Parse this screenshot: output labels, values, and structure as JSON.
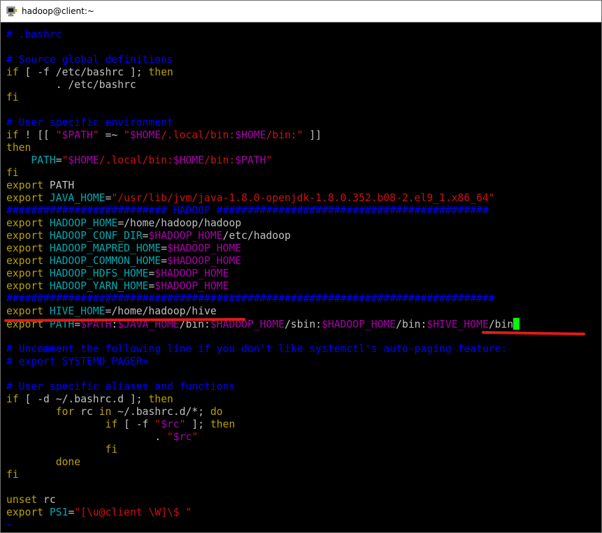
{
  "window": {
    "title": "hadoop@client:~"
  },
  "terminal": {
    "lines": [
      [
        {
          "t": "# .bashrc",
          "c": "comment"
        }
      ],
      [],
      [
        {
          "t": "# Source global definitions",
          "c": "comment"
        }
      ],
      [
        {
          "t": "if",
          "c": "keyword"
        },
        {
          "t": " [ -f /etc/bashrc ]; ",
          "c": "plain"
        },
        {
          "t": "then",
          "c": "keyword"
        }
      ],
      [
        {
          "t": "        . /etc/bashrc",
          "c": "plain"
        }
      ],
      [
        {
          "t": "fi",
          "c": "keyword"
        }
      ],
      [],
      [
        {
          "t": "# User specific environment",
          "c": "comment"
        }
      ],
      [
        {
          "t": "if",
          "c": "keyword"
        },
        {
          "t": " ! [[ ",
          "c": "plain"
        },
        {
          "t": "\"",
          "c": "string"
        },
        {
          "t": "$PATH",
          "c": "var"
        },
        {
          "t": "\"",
          "c": "string"
        },
        {
          "t": " =~ ",
          "c": "plain"
        },
        {
          "t": "\"",
          "c": "string"
        },
        {
          "t": "$HOME",
          "c": "var"
        },
        {
          "t": "/.local/bin:",
          "c": "string"
        },
        {
          "t": "$HOME",
          "c": "var"
        },
        {
          "t": "/bin:\"",
          "c": "string"
        },
        {
          "t": " ]]",
          "c": "plain"
        }
      ],
      [
        {
          "t": "then",
          "c": "keyword"
        }
      ],
      [
        {
          "t": "    PATH",
          "c": "cyan"
        },
        {
          "t": "=",
          "c": "plain"
        },
        {
          "t": "\"",
          "c": "string"
        },
        {
          "t": "$HOME",
          "c": "var"
        },
        {
          "t": "/.local/bin:",
          "c": "string"
        },
        {
          "t": "$HOME",
          "c": "var"
        },
        {
          "t": "/bin:",
          "c": "string"
        },
        {
          "t": "$PATH",
          "c": "var"
        },
        {
          "t": "\"",
          "c": "string"
        }
      ],
      [
        {
          "t": "fi",
          "c": "keyword"
        }
      ],
      [
        {
          "t": "export",
          "c": "keyword"
        },
        {
          "t": " PATH",
          "c": "plain"
        }
      ],
      [
        {
          "t": "export",
          "c": "keyword"
        },
        {
          "t": " JAVA_HOME",
          "c": "cyan"
        },
        {
          "t": "=",
          "c": "plain"
        },
        {
          "t": "\"/usr/lib/jvm/java-1.8.0-openjdk-1.8.0.352.b08-2.el9_1.x86_64\"",
          "c": "string"
        }
      ],
      [
        {
          "t": "########################## HADOOP ############################################",
          "c": "comment"
        }
      ],
      [
        {
          "t": "export",
          "c": "keyword"
        },
        {
          "t": " HADOOP_HOME",
          "c": "cyan"
        },
        {
          "t": "=/home/hadoop/hadoop",
          "c": "plain"
        }
      ],
      [
        {
          "t": "export",
          "c": "keyword"
        },
        {
          "t": " HADOOP_CONF_DIR",
          "c": "cyan"
        },
        {
          "t": "=",
          "c": "plain"
        },
        {
          "t": "$HADOOP_HOME",
          "c": "var"
        },
        {
          "t": "/etc/hadoop",
          "c": "plain"
        }
      ],
      [
        {
          "t": "export",
          "c": "keyword"
        },
        {
          "t": " HADOOP_MAPRED_HOME",
          "c": "cyan"
        },
        {
          "t": "=",
          "c": "plain"
        },
        {
          "t": "$HADOOP_HOME",
          "c": "var"
        }
      ],
      [
        {
          "t": "export",
          "c": "keyword"
        },
        {
          "t": " HADOOP_COMMON_HOME",
          "c": "cyan"
        },
        {
          "t": "=",
          "c": "plain"
        },
        {
          "t": "$HADOOP_HOME",
          "c": "var"
        }
      ],
      [
        {
          "t": "export",
          "c": "keyword"
        },
        {
          "t": " HADOOP_HDFS_HOME",
          "c": "cyan"
        },
        {
          "t": "=",
          "c": "plain"
        },
        {
          "t": "$HADOOP_HOME",
          "c": "var"
        }
      ],
      [
        {
          "t": "export",
          "c": "keyword"
        },
        {
          "t": " HADOOP_YARN_HOME",
          "c": "cyan"
        },
        {
          "t": "=",
          "c": "plain"
        },
        {
          "t": "$HADOOP_HOME",
          "c": "var"
        }
      ],
      [
        {
          "t": "###############################################################################",
          "c": "comment"
        }
      ],
      [
        {
          "t": "export",
          "c": "keyword"
        },
        {
          "t": " HIVE_HOME",
          "c": "cyan"
        },
        {
          "t": "=/home/hadoop/hive",
          "c": "plain"
        }
      ],
      [
        {
          "t": "export",
          "c": "keyword"
        },
        {
          "t": " PATH",
          "c": "cyan"
        },
        {
          "t": "=",
          "c": "plain"
        },
        {
          "t": "$PATH",
          "c": "var"
        },
        {
          "t": ":",
          "c": "plain"
        },
        {
          "t": "$JAVA_HOME",
          "c": "var"
        },
        {
          "t": "/bin:",
          "c": "plain"
        },
        {
          "t": "$HADOOP_HOME",
          "c": "var"
        },
        {
          "t": "/sbin:",
          "c": "plain"
        },
        {
          "t": "$HADOOP_HOME",
          "c": "var"
        },
        {
          "t": "/bin:",
          "c": "plain"
        },
        {
          "t": "$HIVE_HOME",
          "c": "var"
        },
        {
          "t": "/bin",
          "c": "plain"
        },
        {
          "t": "",
          "c": "cursor"
        }
      ],
      [],
      [
        {
          "t": "# Uncomment the following line if you don't like systemctl's auto-paging feature:",
          "c": "comment"
        }
      ],
      [
        {
          "t": "# export SYSTEMD_PAGER=",
          "c": "comment"
        }
      ],
      [],
      [
        {
          "t": "# User specific aliases and functions",
          "c": "comment"
        }
      ],
      [
        {
          "t": "if",
          "c": "keyword"
        },
        {
          "t": " [ -d ~/.bashrc.d ]; ",
          "c": "plain"
        },
        {
          "t": "then",
          "c": "keyword"
        }
      ],
      [
        {
          "t": "        ",
          "c": "plain"
        },
        {
          "t": "for",
          "c": "keyword"
        },
        {
          "t": " rc ",
          "c": "plain"
        },
        {
          "t": "in",
          "c": "keyword"
        },
        {
          "t": " ~/.bashrc.d/*; ",
          "c": "plain"
        },
        {
          "t": "do",
          "c": "keyword"
        }
      ],
      [
        {
          "t": "                ",
          "c": "plain"
        },
        {
          "t": "if",
          "c": "keyword"
        },
        {
          "t": " [ -f ",
          "c": "plain"
        },
        {
          "t": "\"",
          "c": "string"
        },
        {
          "t": "$rc",
          "c": "var"
        },
        {
          "t": "\"",
          "c": "string"
        },
        {
          "t": " ]; ",
          "c": "plain"
        },
        {
          "t": "then",
          "c": "keyword"
        }
      ],
      [
        {
          "t": "                        . ",
          "c": "plain"
        },
        {
          "t": "\"",
          "c": "string"
        },
        {
          "t": "$rc",
          "c": "var"
        },
        {
          "t": "\"",
          "c": "string"
        }
      ],
      [
        {
          "t": "                ",
          "c": "plain"
        },
        {
          "t": "fi",
          "c": "keyword"
        }
      ],
      [
        {
          "t": "        ",
          "c": "plain"
        },
        {
          "t": "done",
          "c": "keyword"
        }
      ],
      [
        {
          "t": "fi",
          "c": "keyword"
        }
      ],
      [],
      [
        {
          "t": "unset",
          "c": "keyword"
        },
        {
          "t": " rc",
          "c": "plain"
        }
      ],
      [
        {
          "t": "export",
          "c": "keyword"
        },
        {
          "t": " PS1",
          "c": "cyan"
        },
        {
          "t": "=",
          "c": "plain"
        },
        {
          "t": "\"[\\u@client \\W]\\$ \"",
          "c": "string"
        }
      ],
      [
        {
          "t": "~",
          "c": "tilde"
        }
      ]
    ]
  },
  "colors": {
    "comment": "#0000ff",
    "keyword": "#b9a100",
    "plain": "#c0c0c0",
    "string": "#cc1111",
    "variable": "#aa00aa",
    "identifier": "#00a9b0",
    "cursor": "#00ff00",
    "annotation": "#e11a1a"
  }
}
